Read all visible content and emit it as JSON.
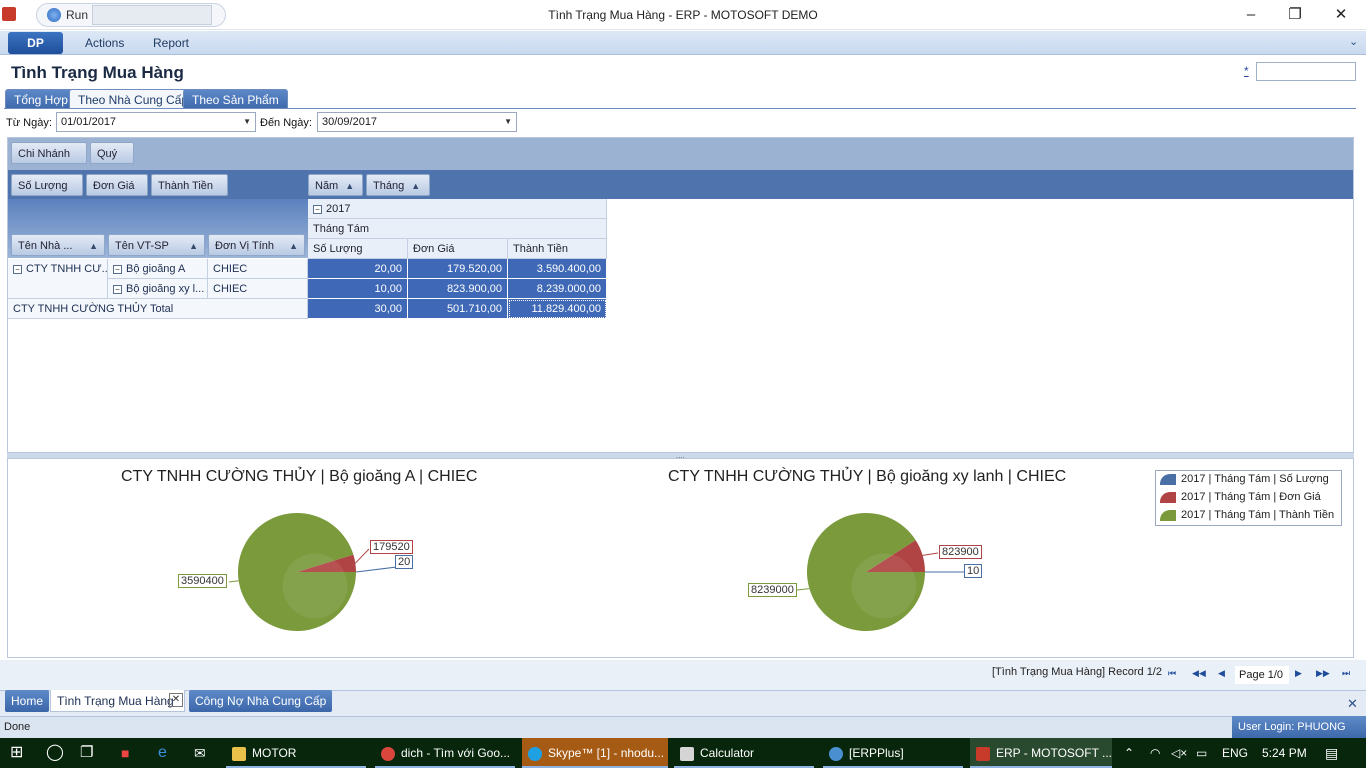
{
  "window": {
    "title": "Tình Trạng Mua Hàng - ERP - MOTOSOFT DEMO",
    "run_label": "Run",
    "controls": [
      "–",
      "❐",
      "✕"
    ]
  },
  "menu": {
    "logo": "DP",
    "actions": "Actions",
    "report": "Report"
  },
  "page": {
    "title": "Tình Trạng Mua Hàng",
    "star_link": "*"
  },
  "tabs": [
    {
      "label": "Tổng Hợp",
      "active": false
    },
    {
      "label": "Theo Nhà Cung Cấp",
      "active": true
    },
    {
      "label": "Theo Sản Phẩm",
      "active": false
    }
  ],
  "filter": {
    "from_label": "Từ Ngày:",
    "from_value": "01/01/2017",
    "to_label": "Đến Ngày:",
    "to_value": "30/09/2017"
  },
  "pivot": {
    "filter_fields": [
      "Chi Nhánh",
      "Quý"
    ],
    "data_fields": [
      "Số Lượng",
      "Đơn Giá",
      "Thành Tiền"
    ],
    "column_fields": [
      "Năm",
      "Tháng"
    ],
    "row_fields": [
      "Tên Nhà ...",
      "Tên VT-SP",
      "Đơn Vị Tính"
    ],
    "year": "2017",
    "month": "Tháng Tám",
    "measure_headers": [
      "Số Lượng",
      "Đơn Giá",
      "Thành Tiền"
    ],
    "supplier": "CTY TNHH CƯ...",
    "rows": [
      {
        "product": "Bộ gioăng A",
        "unit": "CHIEC",
        "values": [
          "20,00",
          "179.520,00",
          "3.590.400,00"
        ]
      },
      {
        "product": "Bộ gioăng xy l...",
        "unit": "CHIEC",
        "values": [
          "10,00",
          "823.900,00",
          "8.239.000,00"
        ]
      }
    ],
    "total": {
      "label": "CTY TNHH CƯỜNG THỦY Total",
      "values": [
        "30,00",
        "501.710,00",
        "11.829.400,00"
      ]
    },
    "splitter_handle": "....",
    "sort_glyph": "▲",
    "collapse_glyph": "−"
  },
  "chart_data": [
    {
      "type": "pie",
      "title": "CTY TNHH CƯỜNG THỦY | Bộ gioăng A | CHIEC",
      "slices": [
        {
          "label": "2017 | Tháng Tám | Số Lượng",
          "value": 20,
          "color": "#4a6fa5"
        },
        {
          "label": "2017 | Tháng Tám | Đơn Giá",
          "value": 179520,
          "color": "#b04444"
        },
        {
          "label": "2017 | Tháng Tám | Thành Tiền",
          "value": 3590400,
          "color": "#7a9a3c"
        }
      ],
      "data_labels": [
        "20",
        "179520",
        "3590400"
      ],
      "legend": "top-right"
    },
    {
      "type": "pie",
      "title": "CTY TNHH CƯỜNG THỦY | Bộ gioăng xy lanh | CHIEC",
      "slices": [
        {
          "label": "2017 | Tháng Tám | Số Lượng",
          "value": 10,
          "color": "#4a6fa5"
        },
        {
          "label": "2017 | Tháng Tám | Đơn Giá",
          "value": 823900,
          "color": "#b04444"
        },
        {
          "label": "2017 | Tháng Tám | Thành Tiền",
          "value": 8239000,
          "color": "#7a9a3c"
        }
      ],
      "data_labels": [
        "10",
        "823900",
        "8239000"
      ],
      "legend": "top-right"
    }
  ],
  "legend_items": [
    {
      "label": "2017 | Tháng Tám | Số Lượng",
      "color": "#4a6fa5"
    },
    {
      "label": "2017 | Tháng Tám | Đơn Giá",
      "color": "#b04444"
    },
    {
      "label": "2017 | Tháng Tám | Thành Tiền",
      "color": "#7a9a3c"
    }
  ],
  "navigator": {
    "record_text": "[Tình Trạng Mua Hàng] Record 1/2",
    "page_text": "Page 1/0",
    "buttons": [
      "⏮",
      "◀◀",
      "◀",
      "▶",
      "▶▶",
      "⏭"
    ]
  },
  "doc_tabs": [
    {
      "label": "Home",
      "active": false
    },
    {
      "label": "Tình Trạng Mua Hàng",
      "active": true
    },
    {
      "label": "Công Nợ Nhà Cung Cấp",
      "active": false
    }
  ],
  "close_glyph": "✕",
  "status": {
    "text": "Done",
    "user": "User Login: PHUONG"
  },
  "taskbar": {
    "items": [
      "MOTOR",
      "dich - Tìm với Goo...",
      "Skype™ [1] - nhodu...",
      "Calculator",
      "[ERPPlus]",
      "ERP - MOTOSOFT ..."
    ],
    "lang": "ENG",
    "time": "5:24 PM"
  }
}
